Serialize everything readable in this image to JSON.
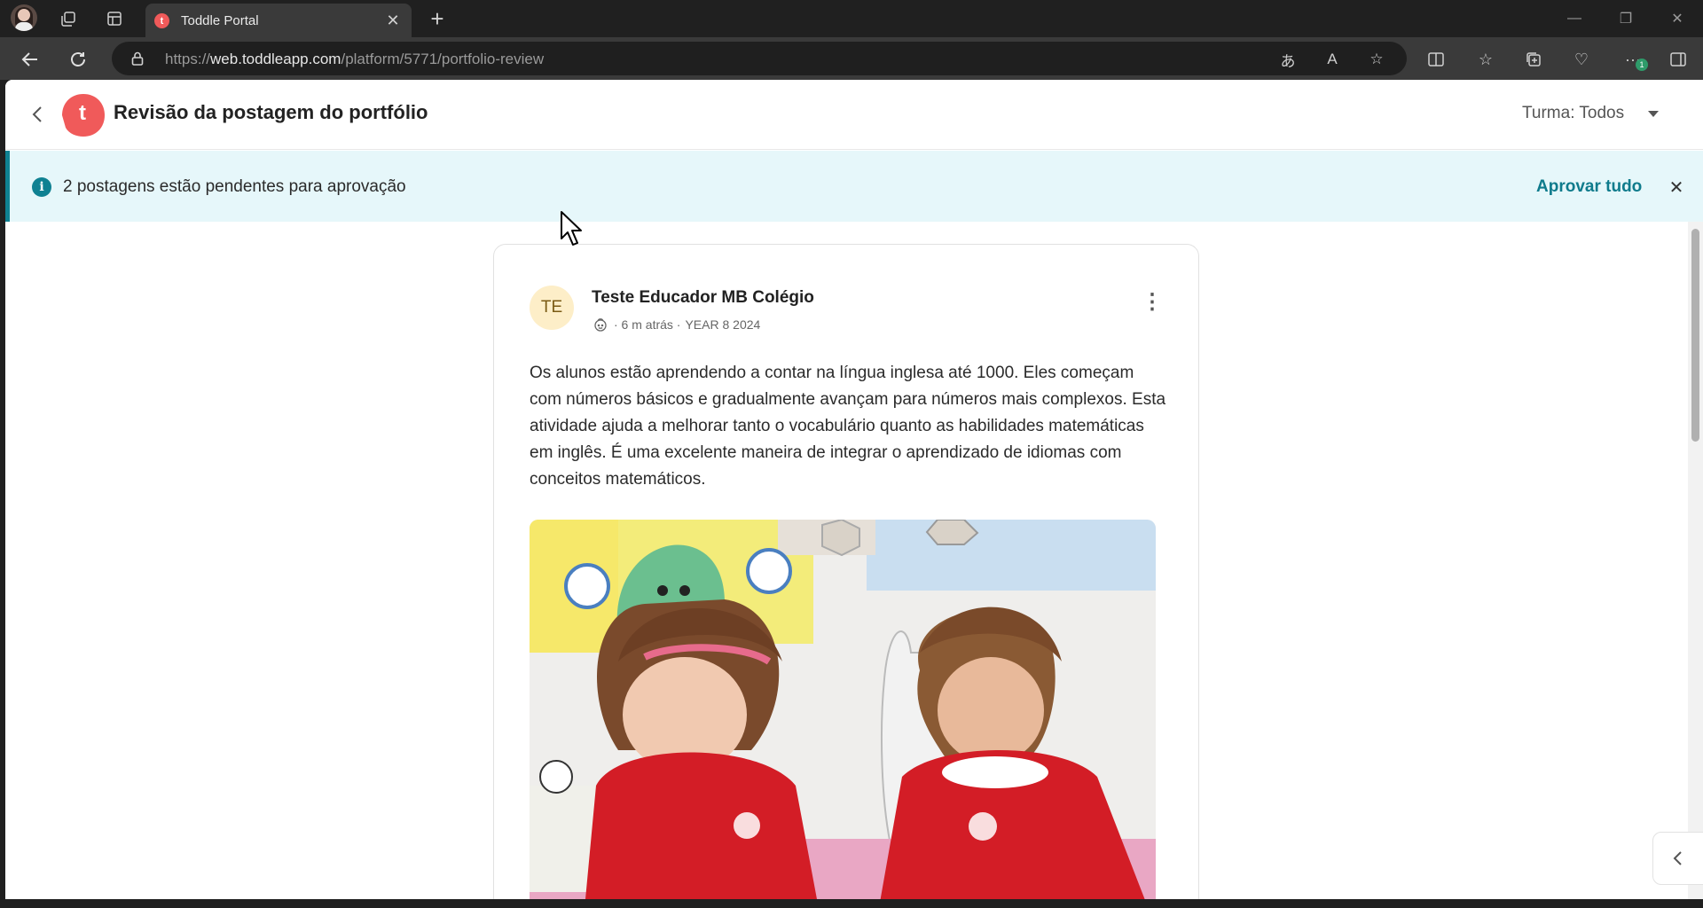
{
  "browser": {
    "tab_title": "Toddle Portal",
    "url_prefix": "https://",
    "url_host": "web.toddleapp.com",
    "url_path": "/platform/5771/portfolio-review",
    "notification_count": "1"
  },
  "header": {
    "title": "Revisão da postagem do portfólio",
    "logo_letter": "t",
    "class_filter": "Turma: Todos"
  },
  "banner": {
    "message": "2 postagens estão pendentes para aprovação",
    "approve_all": "Aprovar tudo"
  },
  "post": {
    "avatar_initials": "TE",
    "author": "Teste Educador MB Colégio",
    "time": "· 6 m atrás ·",
    "group": "YEAR 8 2024",
    "text": "Os alunos estão aprendendo a contar na língua inglesa até 1000. Eles começam com números básicos e gradualmente avançam para números mais complexos. Esta atividade ajuda a melhorar tanto o vocabulário quanto as habilidades matemáticas em inglês. É uma excelente maneira de integrar o aprendizado de idiomas com conceitos matemáticos."
  },
  "colors": {
    "brand": "#f05a5a",
    "accent": "#0f8192",
    "banner_bg": "#e6f7fa"
  }
}
